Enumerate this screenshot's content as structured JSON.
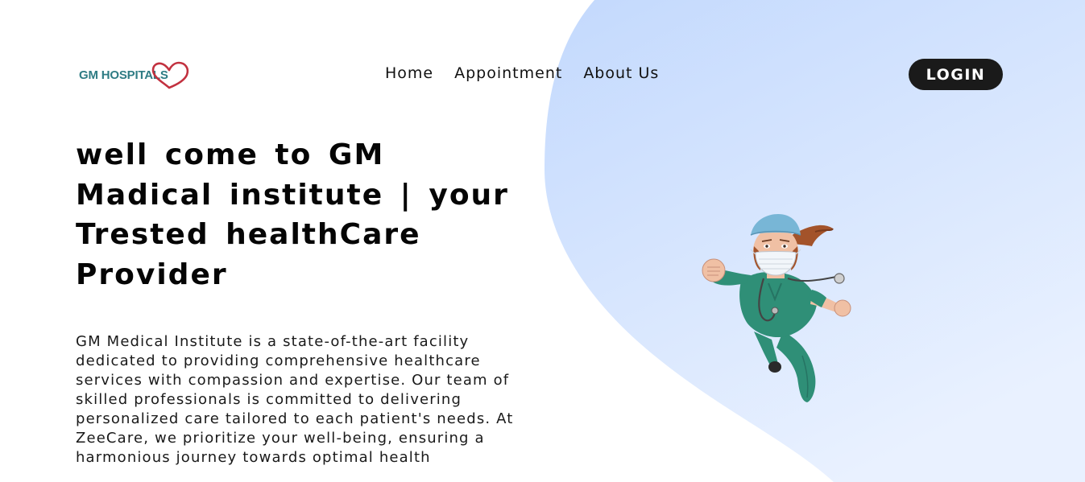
{
  "header": {
    "logo_text": "GM HOSPITALS",
    "nav": [
      {
        "label": "Home"
      },
      {
        "label": "Appointment"
      },
      {
        "label": "About Us"
      }
    ],
    "login_label": "LOGIN"
  },
  "hero": {
    "title": "well come to GM Madical institute | your Trested healthCare Provider",
    "description": "GM Medical Institute is a state-of-the-art facility dedicated to providing comprehensive healthcare services with compassion and expertise. Our team of skilled professionals is committed to delivering personalized care tailored to each patient's needs. At ZeeCare, we prioritize your well-being, ensuring a harmonious journey towards optimal health"
  },
  "colors": {
    "background": "#ffffff",
    "blob_start": "#c7dcfd",
    "blob_end": "#eaf2ff",
    "logo_teal": "#2f7c84",
    "logo_heart": "#c2313f",
    "login_bg": "#1a1a1a",
    "text": "#111111"
  },
  "icons": {
    "logo_heart": "heart-icon",
    "hero_illustration": "superhero-nurse-illustration"
  }
}
